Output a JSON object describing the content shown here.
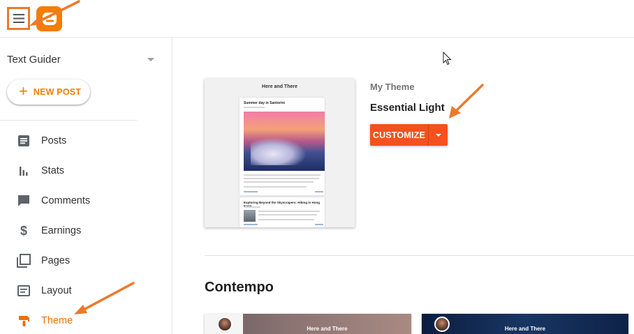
{
  "topbar": {
    "menu_icon": "hamburger-menu-icon",
    "logo_icon": "blogger-logo-icon"
  },
  "sidebar": {
    "blog_name": "Text Guider",
    "new_post_label": "NEW POST",
    "items": [
      {
        "label": "Posts",
        "icon": "posts-icon"
      },
      {
        "label": "Stats",
        "icon": "stats-icon"
      },
      {
        "label": "Comments",
        "icon": "comments-icon"
      },
      {
        "label": "Earnings",
        "icon": "dollar-icon"
      },
      {
        "label": "Pages",
        "icon": "pages-icon"
      },
      {
        "label": "Layout",
        "icon": "layout-icon"
      },
      {
        "label": "Theme",
        "icon": "theme-icon",
        "active": true
      }
    ]
  },
  "main": {
    "preview": {
      "blog_title": "Here and There",
      "post1_title": "Summer day in Santorini",
      "post2_title": "Exploring Beyond the Skyscrapers: Hiking in Hong Kong"
    },
    "my_theme_label": "My Theme",
    "theme_name": "Essential Light",
    "customize_label": "CUSTOMIZE",
    "section_title": "Contempo",
    "thumbs": [
      {
        "title": "Here and There"
      },
      {
        "title": "Here and There"
      }
    ]
  },
  "colors": {
    "accent": "#f57d00",
    "customize": "#f4511e",
    "annotation": "#ec7a2a",
    "active_nav": "#e8710a"
  }
}
